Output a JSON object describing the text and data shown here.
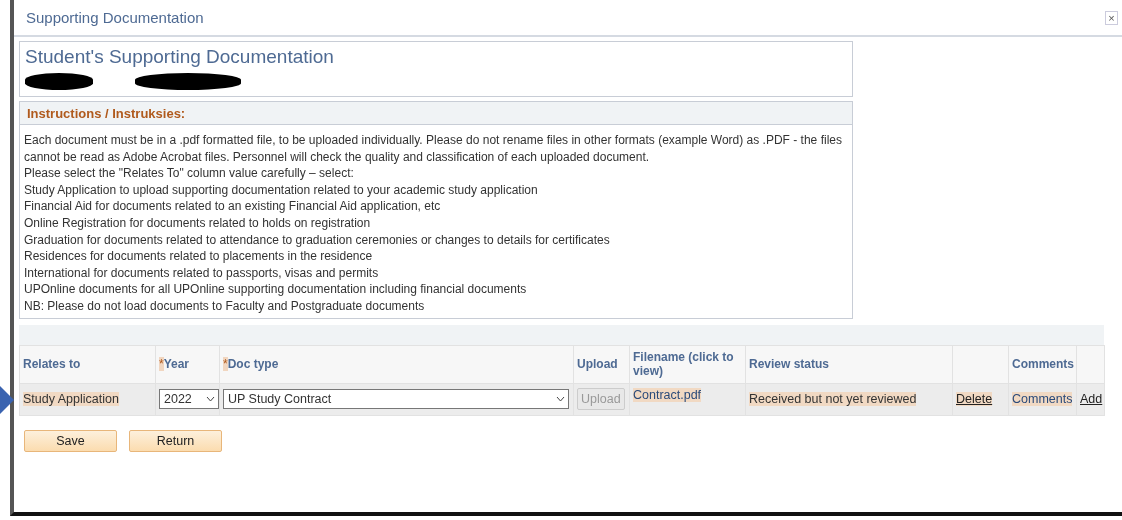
{
  "window": {
    "title": "Supporting Documentation",
    "close": "×"
  },
  "page_title": "Student's Supporting Documentation",
  "instructions": {
    "heading": "Instructions / Instruksies:",
    "lines": [
      "Each document must be in a .pdf formatted file, to be uploaded individually. Please do not rename files in other formats (example Word) as .PDF - the files cannot be read as Adobe Acrobat files. Personnel will check the quality and classification of each uploaded document.",
      "Please select the \"Relates To\" column value carefully – select:",
      "Study Application to upload supporting documentation related to your academic study application",
      "Financial Aid for documents related to an existing Financial Aid application, etc",
      "Online Registration for documents related to holds on registration",
      "Graduation for documents related to attendance to graduation ceremonies or changes to details for certificates",
      "Residences for documents related to placements in the residence",
      "International for documents related to passports, visas and permits",
      "UPOnline documents for all UPOnline supporting documentation including financial documents",
      "NB: Please do not load documents to Faculty and Postgraduate documents"
    ]
  },
  "table": {
    "columns": [
      {
        "label": "Relates to"
      },
      {
        "label": "Year",
        "required_mark": "*"
      },
      {
        "label": "Doc type",
        "required_mark": "*"
      },
      {
        "label": "Upload"
      },
      {
        "label": "Filename (click to view)"
      },
      {
        "label": "Review status"
      },
      {},
      {
        "label": "Comments"
      },
      {}
    ],
    "rows": [
      {
        "current": true,
        "relates_to": "Study Application",
        "year": "2022",
        "doc_type": "UP Study Contract",
        "upload": {
          "label": "Upload",
          "disabled": true
        },
        "filename": "Contract.pdf",
        "review_status": "Received but not yet reviewed",
        "delete": "Delete",
        "comments": "Comments",
        "add": "Add"
      }
    ]
  },
  "buttons": [
    "Save",
    "Return"
  ]
}
